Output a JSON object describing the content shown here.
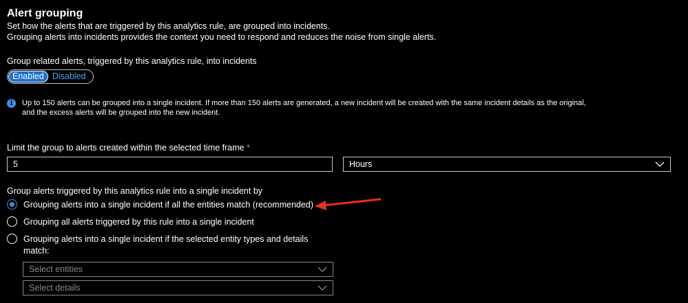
{
  "section": {
    "title": "Alert grouping",
    "desc_line1": "Set how the alerts that are triggered by this analytics rule, are grouped into incidents.",
    "desc_line2": "Grouping alerts into incidents provides the context you need to respond and reduces the noise from single alerts."
  },
  "group_toggle": {
    "label": "Group related alerts, triggered by this analytics rule, into incidents",
    "options": [
      "Enabled",
      "Disabled"
    ],
    "selected": "Enabled"
  },
  "info": {
    "icon": "info-icon",
    "line1": "Up to 150 alerts can be grouped into a single incident. If more than 150 alerts are generated, a new incident will be created with the same incident details as the original,",
    "line2": "and the excess alerts will be grouped into the new incident."
  },
  "time_frame": {
    "label": "Limit the group to alerts created within the selected time frame",
    "required_mark": "*",
    "value": "5",
    "unit": "Hours"
  },
  "grouping": {
    "label": "Group alerts triggered by this analytics rule into a single incident by",
    "options": [
      {
        "label": "Grouping alerts into a single incident if all the entities match (recommended)",
        "checked": true
      },
      {
        "label": "Grouping all alerts triggered by this rule into a single incident",
        "checked": false
      },
      {
        "label_line1": "Grouping alerts into a single incident if the selected entity types and details",
        "label_line2": "match:",
        "checked": false
      }
    ],
    "select_entities_placeholder": "Select entities",
    "select_details_placeholder": "Select details"
  },
  "colors": {
    "accent": "#1b6fd0",
    "link": "#3ea2ff",
    "info": "#3c8ee8",
    "required": "#f1707b",
    "annotation_arrow": "#e8321e"
  }
}
